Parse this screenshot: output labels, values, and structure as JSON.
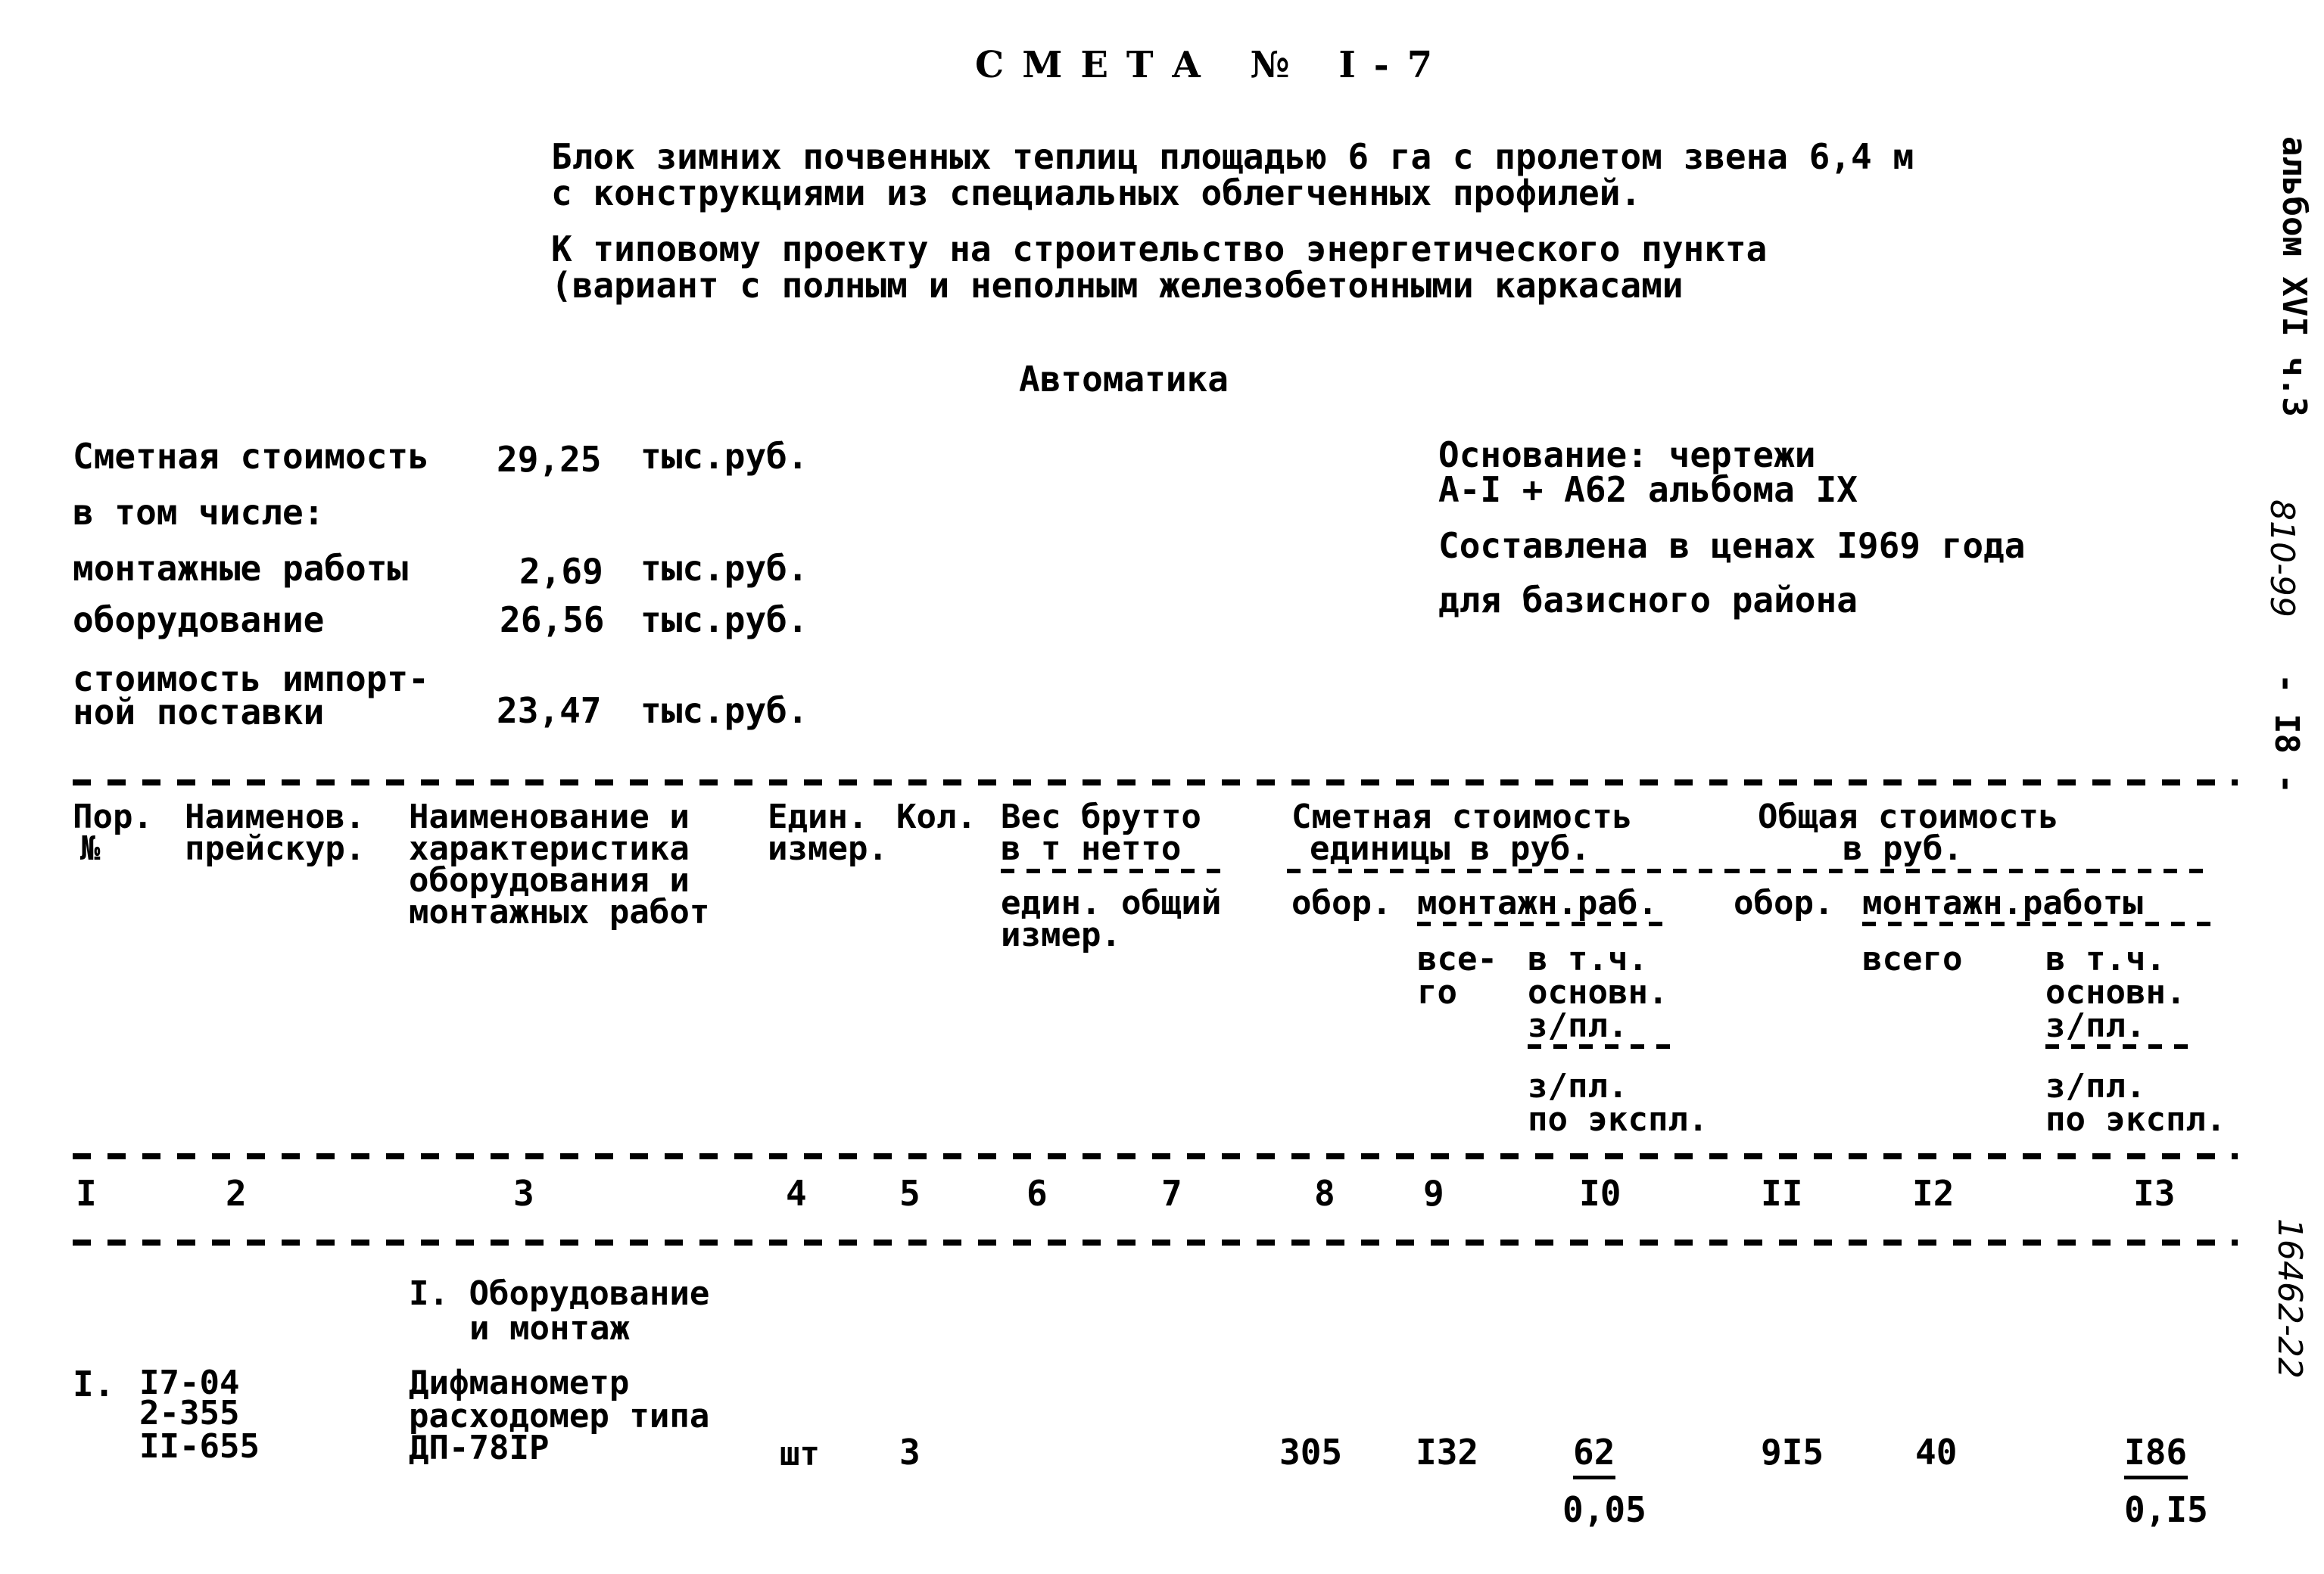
{
  "document": {
    "title": "СМЕТА № I-7",
    "subtitle_lines": [
      "Блок зимних почвенных теплиц площадью 6 га с пролетом звена 6,4 м",
      "с конструкциями из специальных облегченных профилей."
    ],
    "project_lines": [
      "К типовому проекту на строительство энергетического пункта",
      "(вариант с полным и неполным железобетонными каркасами"
    ],
    "section_heading": "Автоматика"
  },
  "costs": {
    "total_label": "Сметная стоимость",
    "total_value": "29,25",
    "unit": "тыс.руб.",
    "including_label": "в том числе:",
    "items": [
      {
        "label": "монтажные работы",
        "value": "2,69",
        "unit": "тыс.руб."
      },
      {
        "label": "оборудование",
        "value": "26,56",
        "unit": "тыс.руб."
      },
      {
        "label_line1": "стоимость импорт-",
        "label_line2": "ной поставки",
        "value": "23,47",
        "unit": "тыс.руб."
      }
    ]
  },
  "basis": {
    "line1": "Основание: чертежи",
    "line2": "А-I + А62 альбома IX",
    "line3": "Составлена в ценах I969 года",
    "line4": "для базисного района"
  },
  "margin": {
    "album": "альбом XVI ч.3",
    "code": "810-99",
    "page": "- I8 -",
    "inventory": "16462-22"
  },
  "table": {
    "headers": {
      "c1": [
        "Пор.",
        "№"
      ],
      "c2": [
        "Наименов.",
        "прейскур."
      ],
      "c3": [
        "Наименование и",
        "характеристика",
        "оборудования и",
        "монтажных работ"
      ],
      "c4": [
        "Един.",
        "измер."
      ],
      "c5": [
        "Кол."
      ],
      "weight_top": [
        "Вес брутто",
        "в т нетто"
      ],
      "weight_sub": [
        "един. общий",
        "измер."
      ],
      "unit_cost_top": [
        "Сметная стоимость",
        "единицы в руб."
      ],
      "unit_obor": "обор.",
      "unit_mont": "монтажн.раб.",
      "unit_total": [
        "все-",
        "го"
      ],
      "unit_incl": [
        "в т.ч.",
        "основн.",
        "з/пл.",
        "з/пл.",
        "по экспл."
      ],
      "total_cost_top": [
        "Общая стоимость",
        "в руб."
      ],
      "total_obor": "обор.",
      "total_mont": "монтажн.работы",
      "total_total": "всего",
      "total_incl": [
        "в т.ч.",
        "основн.",
        "з/пл.",
        "з/пл.",
        "по экспл."
      ]
    },
    "column_numbers": [
      "I",
      "2",
      "3",
      "4",
      "5",
      "6",
      "7",
      "8",
      "9",
      "I0",
      "II",
      "I2",
      "I3"
    ],
    "section": [
      "I. Оборудование",
      "и монтаж"
    ],
    "rows": [
      {
        "num": "I.",
        "pricelist": [
          "I7-04",
          "2-355",
          "II-655"
        ],
        "name": [
          "Дифманометр",
          "расходомер типа",
          "ДП-78IР"
        ],
        "unit": "шт",
        "qty": "3",
        "weight_unit": "",
        "weight_total": "",
        "unit_obor": "305",
        "unit_mont_total": "I32",
        "unit_mont_wage": "62",
        "unit_mont_wage_expl": "0,05",
        "total_obor": "9I5",
        "total_mont_total": "40",
        "total_mont_wage": "I86",
        "total_mont_wage_expl": "0,I5"
      }
    ]
  }
}
